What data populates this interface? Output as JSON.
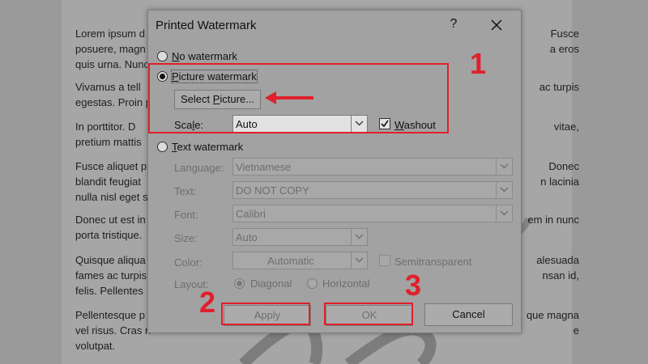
{
  "document": {
    "paragraphs": [
      {
        "lines": [
          {
            "left": "Lorem ipsum d",
            "right": "Fusce"
          },
          {
            "left": "posuere, magn",
            "right": "a eros"
          },
          {
            "left": "quis urna. Nunc",
            "right": ""
          }
        ]
      },
      {
        "lines": [
          {
            "left": "Vivamus a tell",
            "right": "ac turpis"
          },
          {
            "left": "egestas. Proin p",
            "right": ""
          }
        ]
      },
      {
        "lines": [
          {
            "left": "In porttitor. D",
            "right": "vitae,"
          },
          {
            "left": "pretium mattis",
            "right": ""
          }
        ]
      },
      {
        "lines": [
          {
            "left": "Fusce aliquet p",
            "right": "Donec"
          },
          {
            "left": "blandit feugiat",
            "right": "n lacinia"
          },
          {
            "left": "nulla nisl eget s",
            "right": ""
          }
        ]
      },
      {
        "lines": [
          {
            "left": "Donec ut est in",
            "right": "em in nunc"
          },
          {
            "left": "porta tristique.",
            "right": ""
          }
        ]
      },
      {
        "lines": [
          {
            "left": "Quisque aliqua",
            "right": "alesuada"
          },
          {
            "left": "fames ac turpis",
            "right": "nsan id,"
          },
          {
            "left": "felis. Pellentes",
            "right": ""
          }
        ]
      },
      {
        "lines": [
          {
            "left": "Pellentesque p",
            "right": "que magna"
          },
          {
            "left": "vel risus. Cras n",
            "right": "e"
          },
          {
            "left": "volutpat.",
            "right": ""
          }
        ]
      }
    ]
  },
  "dialog": {
    "title": "Printed Watermark",
    "help_label": "?",
    "no_watermark": {
      "prefix": "",
      "accel": "N",
      "rest": "o watermark"
    },
    "picture_watermark": {
      "prefix": "",
      "accel": "P",
      "rest": "icture watermark"
    },
    "select_picture": {
      "prefix": "Select ",
      "accel": "P",
      "rest": "icture..."
    },
    "scale": {
      "prefix": "Sca",
      "accel": "l",
      "rest": "e:",
      "value": "Auto"
    },
    "washout": {
      "prefix": "",
      "accel": "W",
      "rest": "ashout",
      "checked": true
    },
    "text_watermark": {
      "prefix": "",
      "accel": "T",
      "rest": "ext watermark"
    },
    "language": {
      "label": "Language:",
      "value": "Vietnamese"
    },
    "text": {
      "label": "Text:",
      "value": "DO NOT COPY"
    },
    "font": {
      "label": "Font:",
      "value": "Calibri"
    },
    "size": {
      "label": "Size:",
      "value": "Auto"
    },
    "color": {
      "label": "Color:",
      "value": "Automatic"
    },
    "semitransparent": {
      "label": "Semitransparent"
    },
    "layout": {
      "label": "Layout:",
      "diagonal": "Diagonal",
      "horizontal": "Horizontal"
    },
    "buttons": {
      "apply": "Apply",
      "ok": "OK",
      "cancel": "Cancel"
    }
  },
  "annotations": {
    "label_1": "1",
    "label_2": "2",
    "label_3": "3",
    "accent_color": "#e0202a"
  }
}
